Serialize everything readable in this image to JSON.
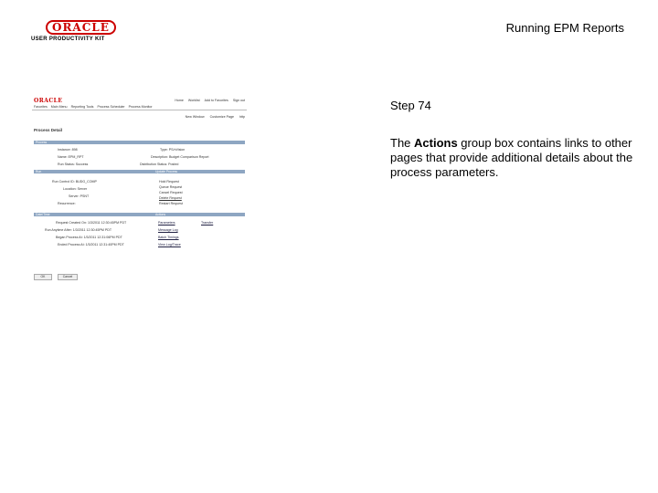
{
  "header": {
    "logo_word": "ORACLE",
    "logo_sub": "USER PRODUCTIVITY KIT",
    "doc_title": "Running EPM Reports"
  },
  "step": {
    "label": "Step 74"
  },
  "description": {
    "pre": "The ",
    "bold": "Actions",
    "post": " group box contains links to other pages that provide additional details about the process parameters."
  },
  "screenshot": {
    "logo": "ORACLE",
    "top_links": [
      "Home",
      "Worklist",
      "Add to Favorites",
      "Sign out"
    ],
    "menu": [
      "Favorites",
      "Main Menu",
      "Reporting Tools",
      "Process Scheduler",
      "Process Monitor"
    ],
    "action_links": [
      "New Window",
      "Customize Page",
      "http"
    ],
    "page_title": "Process Detail",
    "sections": {
      "process": "Process",
      "run": "Run",
      "update_process": "Update Process",
      "date_time": "Date/Time",
      "actions": "Actions"
    },
    "process_fields": [
      "Instance: 898",
      "Type: PS/nVision",
      "Name: EPM_RPT",
      "Description: Budget Comparison Report",
      "Run Status: Success",
      "Distribution Status: Posted"
    ],
    "run_fields": [
      "Run Control ID: BUDG_COMP",
      "Location: Server",
      "Server: PSNT",
      "Recurrence:"
    ],
    "update_process": [
      "Hold Request",
      "Queue Request",
      "Cancel Request",
      "Delete Request",
      "Restart Request"
    ],
    "date_fields": [
      "Request Created On: 1/3/2011 12:30:45PM PDT",
      "Run Anytime After: 1/3/2011 12:30:45PM PDT",
      "Began Process At: 1/3/2011 12:31:06PM PDT",
      "Ended Process At: 1/3/2011 12:31:40PM PDT"
    ],
    "actions": [
      "Parameters",
      "Transfer",
      "Message Log",
      "Batch Timings",
      "View Log/Trace"
    ],
    "buttons": [
      "OK",
      "Cancel"
    ]
  }
}
